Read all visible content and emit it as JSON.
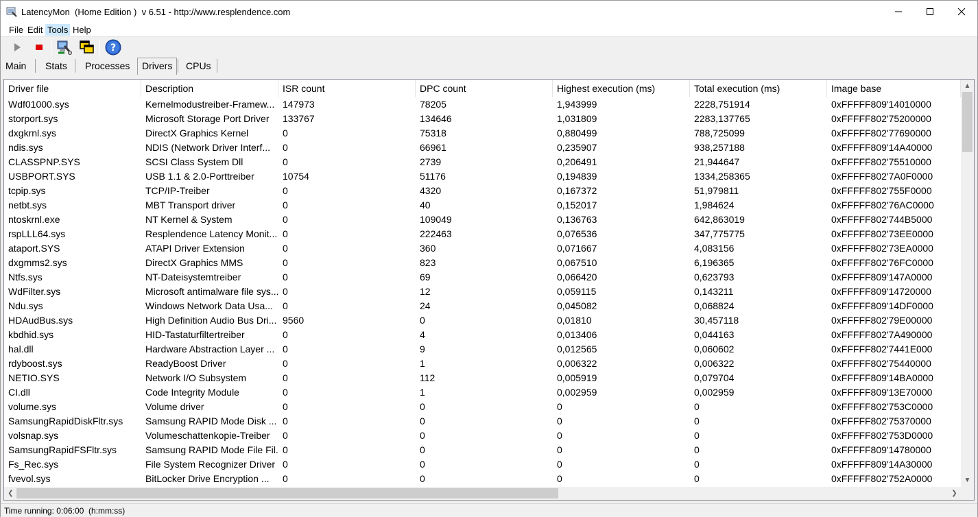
{
  "window": {
    "title": "LatencyMon  (Home Edition )  v 6.51 - http://www.resplendence.com",
    "controls": {
      "minimize": "—",
      "maximize": "☐",
      "close": "✕"
    }
  },
  "menu": {
    "items": [
      "File",
      "Edit",
      "Tools",
      "Help"
    ],
    "active_index": 2
  },
  "toolbar": {
    "buttons": [
      {
        "name": "start-monitor-button",
        "icon": "play-icon"
      },
      {
        "name": "stop-monitor-button",
        "icon": "stop-icon"
      },
      {
        "name": "resplendence-tools-button",
        "icon": "computer-tools-icon"
      },
      {
        "name": "copy-windows-button",
        "icon": "windows-icon"
      },
      {
        "name": "help-button",
        "icon": "help-icon"
      }
    ],
    "help_glyph": "?"
  },
  "tabs": {
    "items": [
      "Main",
      "Stats",
      "Processes",
      "Drivers",
      "CPUs"
    ],
    "active_index": 3
  },
  "table": {
    "columns": [
      "Driver file",
      "Description",
      "ISR count",
      "DPC count",
      "Highest execution (ms)",
      "Total execution (ms)",
      "Image base"
    ],
    "rows": [
      [
        "Wdf01000.sys",
        "Kernelmodustreiber-Framew...",
        "147973",
        "78205",
        "1,943999",
        "2228,751914",
        "0xFFFFF809'14010000"
      ],
      [
        "storport.sys",
        "Microsoft Storage Port Driver",
        "133767",
        "134646",
        "1,031809",
        "2283,137765",
        "0xFFFFF802'75200000"
      ],
      [
        "dxgkrnl.sys",
        "DirectX Graphics Kernel",
        "0",
        "75318",
        "0,880499",
        "788,725099",
        "0xFFFFF802'77690000"
      ],
      [
        "ndis.sys",
        "NDIS (Network Driver Interf...",
        "0",
        "66961",
        "0,235907",
        "938,257188",
        "0xFFFFF809'14A40000"
      ],
      [
        "CLASSPNP.SYS",
        "SCSI Class System Dll",
        "0",
        "2739",
        "0,206491",
        "21,944647",
        "0xFFFFF802'75510000"
      ],
      [
        "USBPORT.SYS",
        "USB 1.1 & 2.0-Porttreiber",
        "10754",
        "51176",
        "0,194839",
        "1334,258365",
        "0xFFFFF802'7A0F0000"
      ],
      [
        "tcpip.sys",
        "TCP/IP-Treiber",
        "0",
        "4320",
        "0,167372",
        "51,979811",
        "0xFFFFF802'755F0000"
      ],
      [
        "netbt.sys",
        "MBT Transport driver",
        "0",
        "40",
        "0,152017",
        "1,984624",
        "0xFFFFF802'76AC0000"
      ],
      [
        "ntoskrnl.exe",
        "NT Kernel & System",
        "0",
        "109049",
        "0,136763",
        "642,863019",
        "0xFFFFF802'744B5000"
      ],
      [
        "rspLLL64.sys",
        "Resplendence Latency Monit...",
        "0",
        "222463",
        "0,076536",
        "347,775775",
        "0xFFFFF802'73EE0000"
      ],
      [
        "ataport.SYS",
        "ATAPI Driver Extension",
        "0",
        "360",
        "0,071667",
        "4,083156",
        "0xFFFFF802'73EA0000"
      ],
      [
        "dxgmms2.sys",
        "DirectX Graphics MMS",
        "0",
        "823",
        "0,067510",
        "6,196365",
        "0xFFFFF802'76FC0000"
      ],
      [
        "Ntfs.sys",
        "NT-Dateisystemtreiber",
        "0",
        "69",
        "0,066420",
        "0,623793",
        "0xFFFFF809'147A0000"
      ],
      [
        "WdFilter.sys",
        "Microsoft antimalware file sys...",
        "0",
        "12",
        "0,059115",
        "0,143211",
        "0xFFFFF809'14720000"
      ],
      [
        "Ndu.sys",
        "Windows Network Data Usa...",
        "0",
        "24",
        "0,045082",
        "0,068824",
        "0xFFFFF809'14DF0000"
      ],
      [
        "HDAudBus.sys",
        "High Definition Audio Bus Dri...",
        "9560",
        "0",
        "0,01810",
        "30,457118",
        "0xFFFFF802'79E00000"
      ],
      [
        "kbdhid.sys",
        "HID-Tastaturfiltertreiber",
        "0",
        "4",
        "0,013406",
        "0,044163",
        "0xFFFFF802'7A490000"
      ],
      [
        "hal.dll",
        "Hardware Abstraction Layer ...",
        "0",
        "9",
        "0,012565",
        "0,060602",
        "0xFFFFF802'7441E000"
      ],
      [
        "rdyboost.sys",
        "ReadyBoost Driver",
        "0",
        "1",
        "0,006322",
        "0,006322",
        "0xFFFFF802'75440000"
      ],
      [
        "NETIO.SYS",
        "Network I/O Subsystem",
        "0",
        "112",
        "0,005919",
        "0,079704",
        "0xFFFFF809'14BA0000"
      ],
      [
        "CI.dll",
        "Code Integrity Module",
        "0",
        "1",
        "0,002959",
        "0,002959",
        "0xFFFFF809'13E70000"
      ],
      [
        "volume.sys",
        "Volume driver",
        "0",
        "0",
        "0",
        "0",
        "0xFFFFF802'753C0000"
      ],
      [
        "SamsungRapidDiskFltr.sys",
        "Samsung RAPID Mode Disk ...",
        "0",
        "0",
        "0",
        "0",
        "0xFFFFF802'75370000"
      ],
      [
        "volsnap.sys",
        "Volumeschattenkopie-Treiber",
        "0",
        "0",
        "0",
        "0",
        "0xFFFFF802'753D0000"
      ],
      [
        "SamsungRapidFSFltr.sys",
        "Samsung RAPID Mode File Fil...",
        "0",
        "0",
        "0",
        "0",
        "0xFFFFF809'14780000"
      ],
      [
        "Fs_Rec.sys",
        "File System Recognizer Driver",
        "0",
        "0",
        "0",
        "0",
        "0xFFFFF809'14A30000"
      ],
      [
        "fvevol.sys",
        "BitLocker Drive Encryption ...",
        "0",
        "0",
        "0",
        "0",
        "0xFFFFF802'752A0000"
      ]
    ]
  },
  "scrollbars": {
    "up": "▲",
    "down": "▼",
    "left": "❮",
    "right": "❯"
  },
  "status": {
    "text": "Time running: 0:06:00  (h:mm:ss)"
  }
}
